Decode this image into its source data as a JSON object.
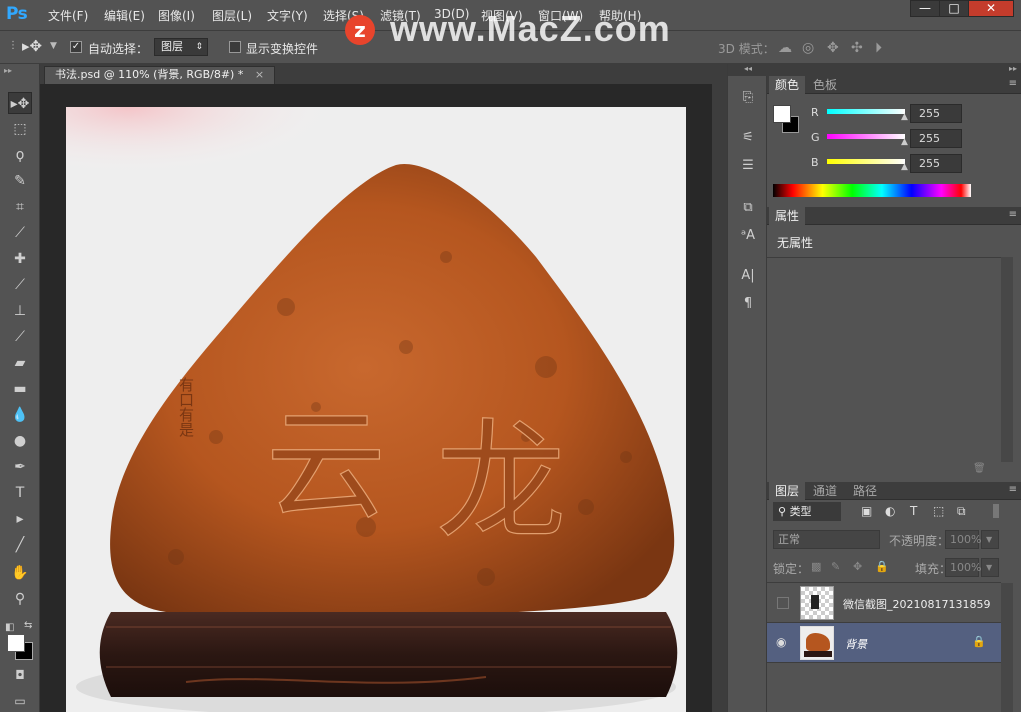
{
  "app": {
    "logo": "Ps"
  },
  "menu": [
    "文件(F)",
    "编辑(E)",
    "图像(I)",
    "图层(L)",
    "文字(Y)",
    "选择(S)",
    "滤镜(T)",
    "3D(D)",
    "视图(V)",
    "窗口(W)",
    "帮助(H)"
  ],
  "window_controls": {
    "minimize": "—",
    "maximize": "□",
    "close": "✕"
  },
  "watermark": {
    "badge": "z",
    "text": "www.MacZ.com"
  },
  "options": {
    "auto_select_label": "自动选择：",
    "auto_select_checked": true,
    "auto_select_value": "图层",
    "show_transform_label": "显示变换控件",
    "mode_3d_label": "3D 模式："
  },
  "document_tab": {
    "title": "书法.psd @ 110% (背景, RGB/8#) *",
    "close": "×"
  },
  "color_panel": {
    "tabs": [
      "颜色",
      "色板"
    ],
    "channels": [
      {
        "label": "R",
        "value": "255",
        "color": "#32e0f0"
      },
      {
        "label": "G",
        "value": "255",
        "color": "#e040e0"
      },
      {
        "label": "B",
        "value": "255",
        "color": "#f0f020"
      }
    ],
    "foreground": "#ffffff",
    "background": "#000000"
  },
  "properties_panel": {
    "title": "属性",
    "text": "无属性"
  },
  "layers_panel": {
    "tabs": [
      "图层",
      "通道",
      "路径"
    ],
    "filter_label": "类型",
    "blend_mode": "正常",
    "opacity_label": "不透明度：",
    "opacity_value": "100%",
    "lock_label": "锁定：",
    "fill_label": "填充：",
    "fill_value": "100%",
    "layers": [
      {
        "name": "微信截图_20210817131859",
        "visible": false,
        "selected": false
      },
      {
        "name": "背景",
        "visible": true,
        "selected": true,
        "locked": true
      }
    ]
  },
  "tools": [
    "move-tool",
    "marquee-tool",
    "lasso-tool",
    "quick-select-tool",
    "crop-tool",
    "eyedropper-tool",
    "healing-tool",
    "brush-tool",
    "stamp-tool",
    "history-brush-tool",
    "eraser-tool",
    "gradient-tool",
    "blur-tool",
    "dodge-tool",
    "pen-tool",
    "type-tool",
    "path-select-tool",
    "line-tool",
    "hand-tool",
    "zoom-tool"
  ],
  "stone": {
    "inscription_left": "云",
    "inscription_right": "龙",
    "side_text": "有口有是"
  }
}
